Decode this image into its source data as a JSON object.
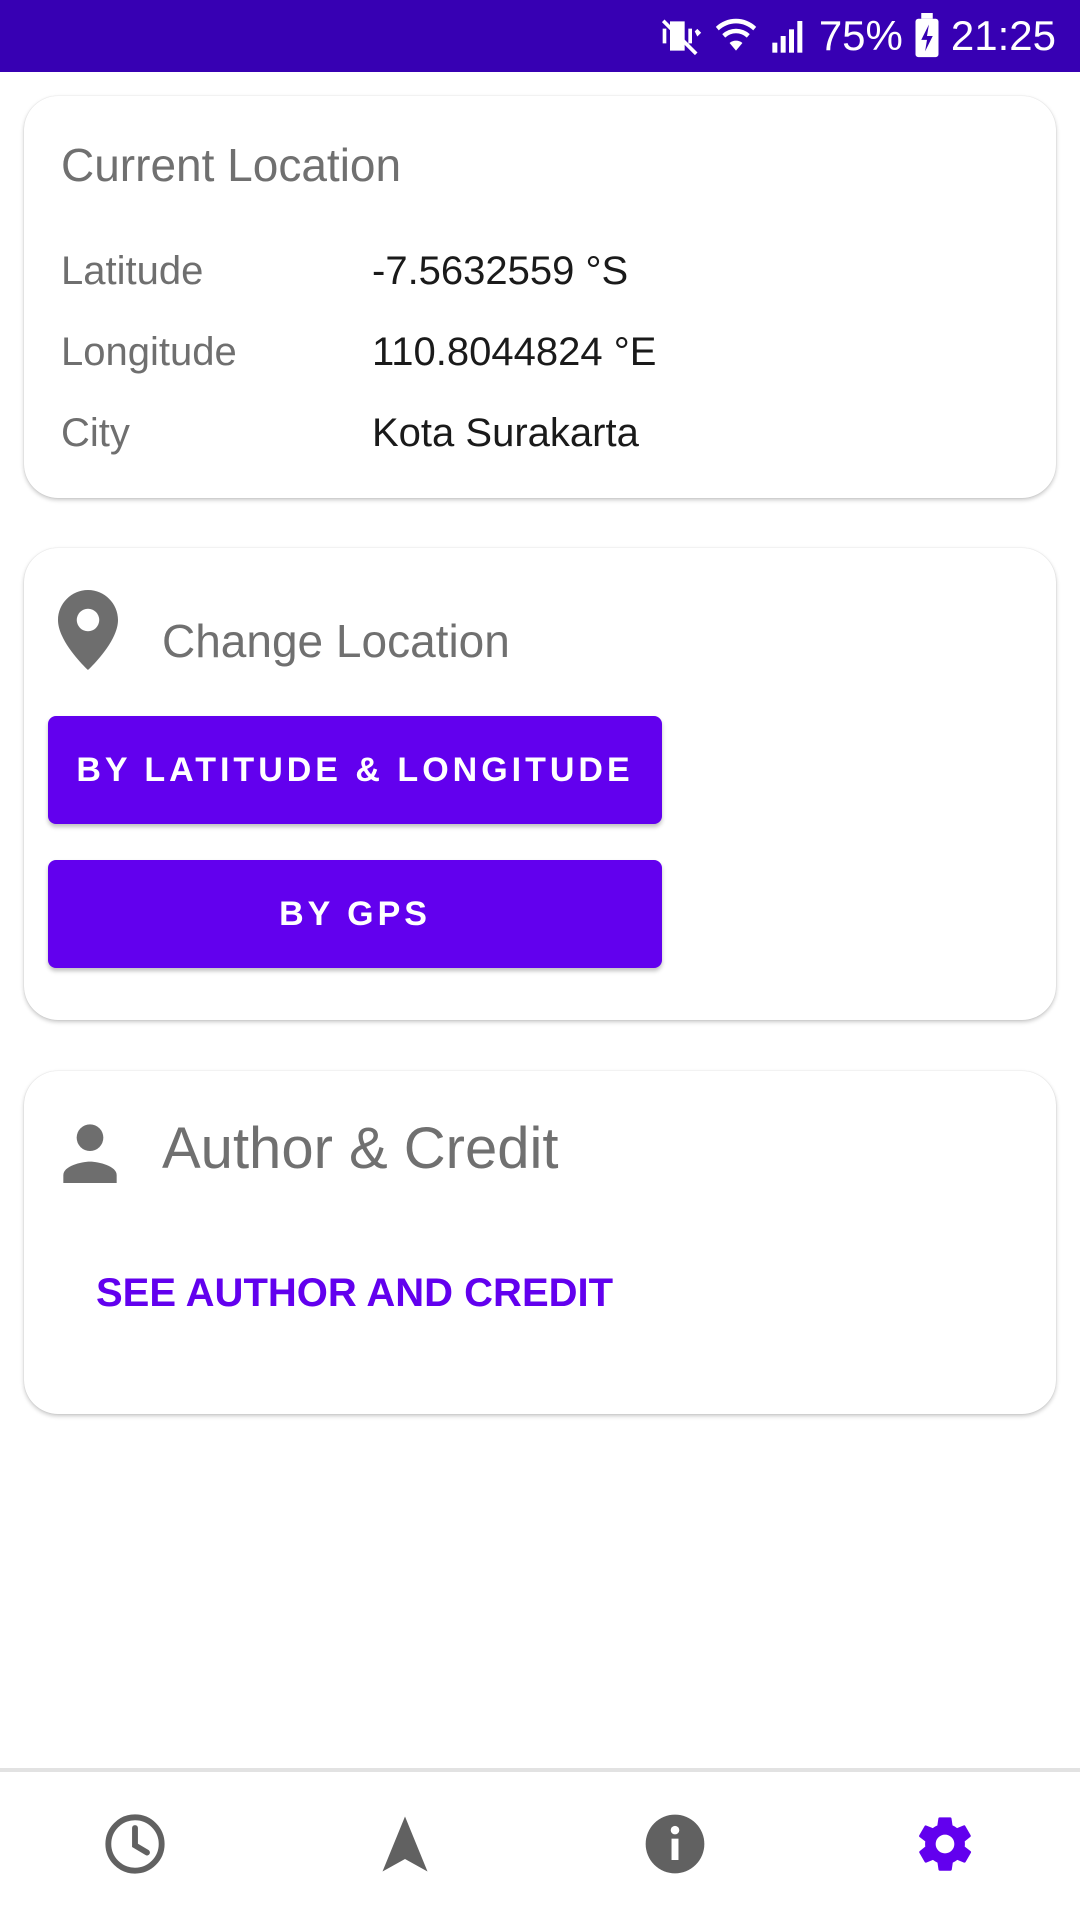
{
  "status_bar": {
    "battery": "75%",
    "time": "21:25",
    "icons": [
      "vibrate-mute-icon",
      "wifi-icon",
      "signal-icon",
      "battery-charging-icon"
    ]
  },
  "current_location": {
    "title": "Current Location",
    "rows": [
      {
        "label": "Latitude",
        "value": "-7.5632559 °S"
      },
      {
        "label": "Longitude",
        "value": "110.8044824 °E"
      },
      {
        "label": "City",
        "value": "Kota Surakarta"
      }
    ]
  },
  "change_location": {
    "icon": "location-pin-icon",
    "title": "Change Location",
    "by_latlng_label": "BY LATITUDE & LONGITUDE",
    "by_gps_label": "BY GPS"
  },
  "author": {
    "icon": "person-icon",
    "title": "Author & Credit",
    "link_label": "SEE AUTHOR AND CREDIT"
  },
  "bottom_nav": {
    "items": [
      "clock-icon",
      "navigation-arrow-icon",
      "info-icon",
      "settings-icon"
    ],
    "active_color": "#6200EE",
    "inactive_color": "#616161"
  },
  "colors": {
    "status_bar": "#3700B3",
    "primary": "#6200EE"
  }
}
